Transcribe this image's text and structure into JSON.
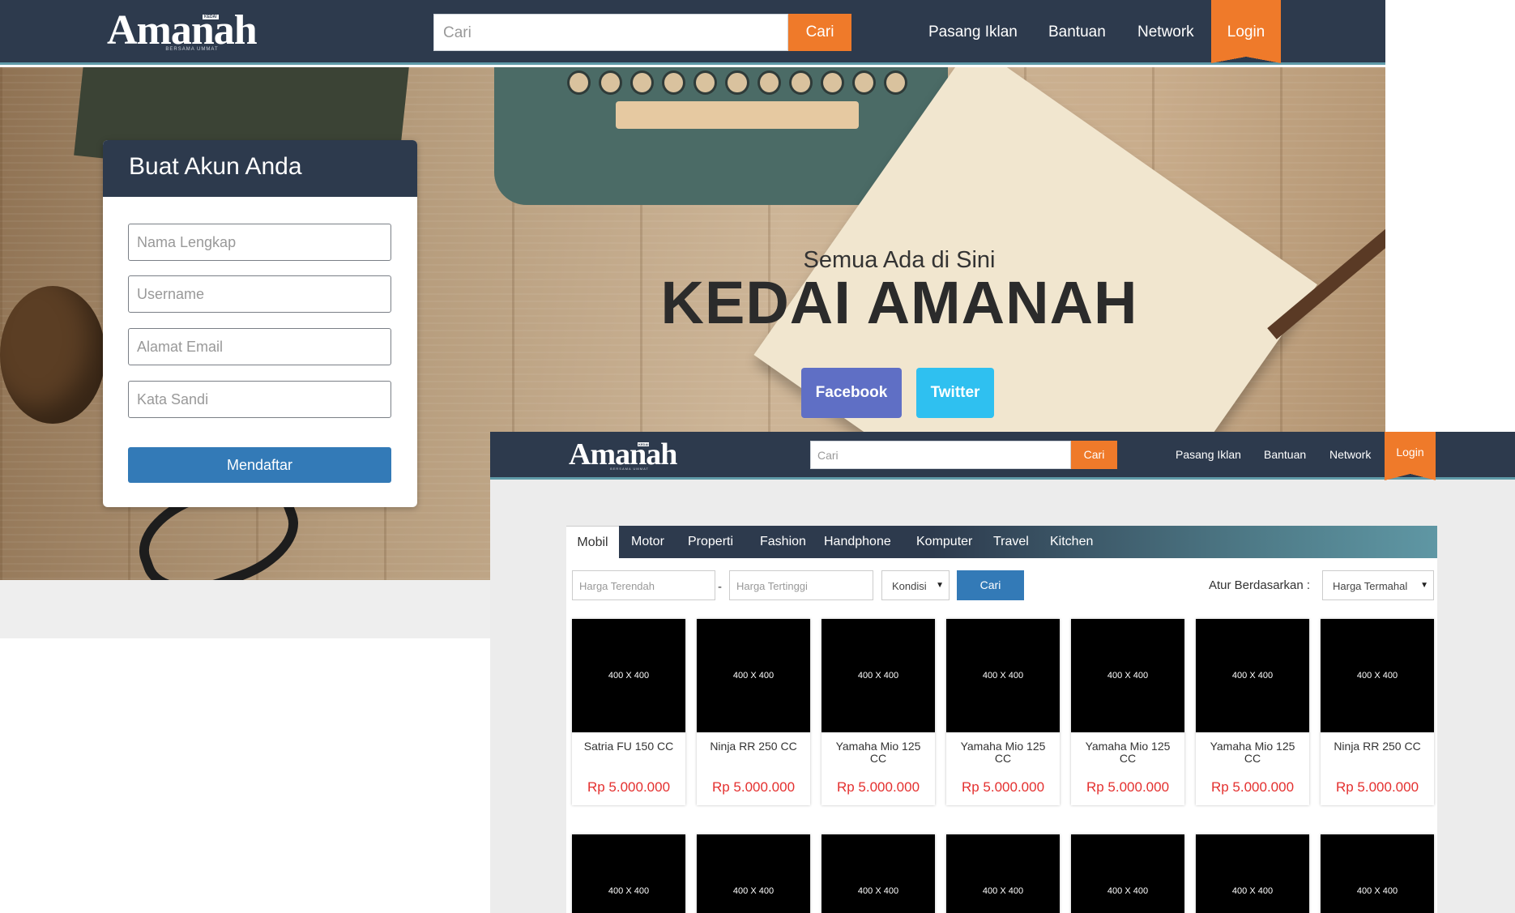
{
  "header": {
    "logo_text": "Amanah",
    "logo_tagline": "BERSAMA UMMAT",
    "logo_badge": "KEDAI",
    "search_placeholder": "Cari",
    "search_button": "Cari",
    "nav": [
      "Pasang Iklan",
      "Bantuan",
      "Network"
    ],
    "login": "Login"
  },
  "hero": {
    "subtitle": "Semua Ada di Sini",
    "title": "KEDAI AMANAH",
    "facebook": "Facebook",
    "twitter": "Twitter"
  },
  "register": {
    "title": "Buat Akun Anda",
    "fields": [
      "Nama Lengkap",
      "Username",
      "Alamat Email",
      "Kata Sandi"
    ],
    "submit": "Mendaftar"
  },
  "catalog": {
    "categories": [
      "Mobil",
      "Motor",
      "Properti",
      "Fashion",
      "Handphone",
      "Komputer",
      "Travel",
      "Kitchen"
    ],
    "active_category": "Mobil",
    "filters": {
      "min_price_placeholder": "Harga Terendah",
      "separator": "-",
      "max_price_placeholder": "Harga Tertinggi",
      "condition": "Kondisi",
      "search_button": "Cari",
      "sort_label": "Atur Berdasarkan :",
      "sort_value": "Harga Termahal"
    },
    "products": [
      {
        "image": "400 X 400",
        "name": "Satria FU 150 CC",
        "price": "Rp 5.000.000"
      },
      {
        "image": "400 X 400",
        "name": "Ninja RR 250 CC",
        "price": "Rp 5.000.000"
      },
      {
        "image": "400 X 400",
        "name": "Yamaha Mio 125 CC",
        "price": "Rp 5.000.000"
      },
      {
        "image": "400 X 400",
        "name": "Yamaha Mio 125 CC",
        "price": "Rp 5.000.000"
      },
      {
        "image": "400 X 400",
        "name": "Yamaha Mio 125 CC",
        "price": "Rp 5.000.000"
      },
      {
        "image": "400 X 400",
        "name": "Yamaha Mio 125 CC",
        "price": "Rp 5.000.000"
      },
      {
        "image": "400 X 400",
        "name": "Ninja RR 250 CC",
        "price": "Rp 5.000.000"
      }
    ],
    "second_row_images": [
      "400 X 400",
      "400 X 400",
      "400 X 400",
      "400 X 400",
      "400 X 400",
      "400 X 400",
      "400 X 400"
    ]
  },
  "colors": {
    "navbar": "#2d3a4d",
    "accent_orange": "#ef7a2a",
    "primary_blue": "#337ab7",
    "price_red": "#e4302f",
    "facebook": "#5f6fc5",
    "twitter": "#2fc0f0"
  }
}
